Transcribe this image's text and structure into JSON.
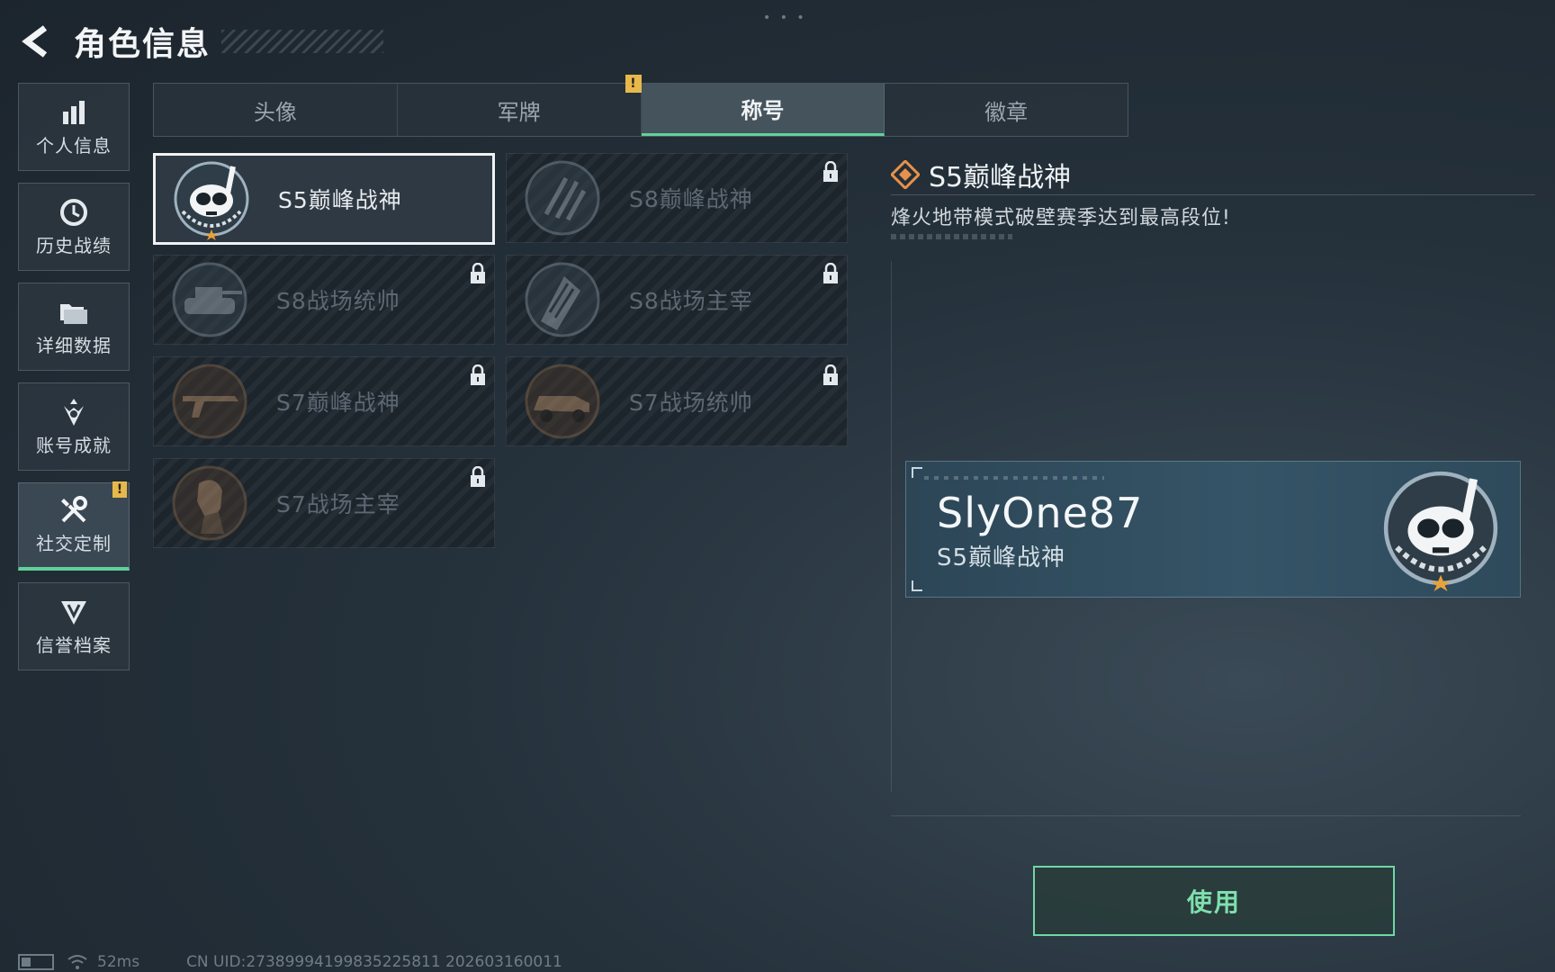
{
  "header": {
    "title": "角色信息"
  },
  "sidebar": {
    "items": [
      {
        "label": "个人信息",
        "icon": "bar-chart-icon"
      },
      {
        "label": "历史战绩",
        "icon": "clock-history-icon"
      },
      {
        "label": "详细数据",
        "icon": "folder-icon"
      },
      {
        "label": "账号成就",
        "icon": "medal-icon"
      },
      {
        "label": "社交定制",
        "icon": "tools-icon",
        "active": true,
        "badge": "!"
      },
      {
        "label": "信誉档案",
        "icon": "shield-emblem-icon"
      }
    ]
  },
  "tabs": [
    {
      "label": "头像"
    },
    {
      "label": "军牌",
      "badge": "!"
    },
    {
      "label": "称号",
      "active": true
    },
    {
      "label": "徽章"
    }
  ],
  "titles": [
    {
      "label": "S5巅峰战神",
      "emblem": "diver-mask-emblem",
      "locked": false,
      "selected": true
    },
    {
      "label": "S8巅峰战神",
      "emblem": "slash-emblem",
      "locked": true
    },
    {
      "label": "S8战场统帅",
      "emblem": "tank-emblem",
      "locked": true
    },
    {
      "label": "S8战场主宰",
      "emblem": "building-emblem",
      "locked": true
    },
    {
      "label": "S7巅峰战神",
      "emblem": "rifle-emblem",
      "locked": true
    },
    {
      "label": "S7战场统帅",
      "emblem": "vehicle-emblem",
      "locked": true
    },
    {
      "label": "S7战场主宰",
      "emblem": "soldier-emblem",
      "locked": true
    }
  ],
  "detail": {
    "title": "S5巅峰战神",
    "description": "烽火地带模式破壁赛季达到最高段位!"
  },
  "preview": {
    "player_name": "SlyOne87",
    "title": "S5巅峰战神"
  },
  "actions": {
    "use_label": "使用"
  },
  "status": {
    "latency": "52ms",
    "uid": "CN UID:2738999419983522581‌1 202603160011"
  },
  "colors": {
    "accent": "#5fd29a",
    "badge": "#e8b84a",
    "emblem_star": "#e8a23a"
  }
}
